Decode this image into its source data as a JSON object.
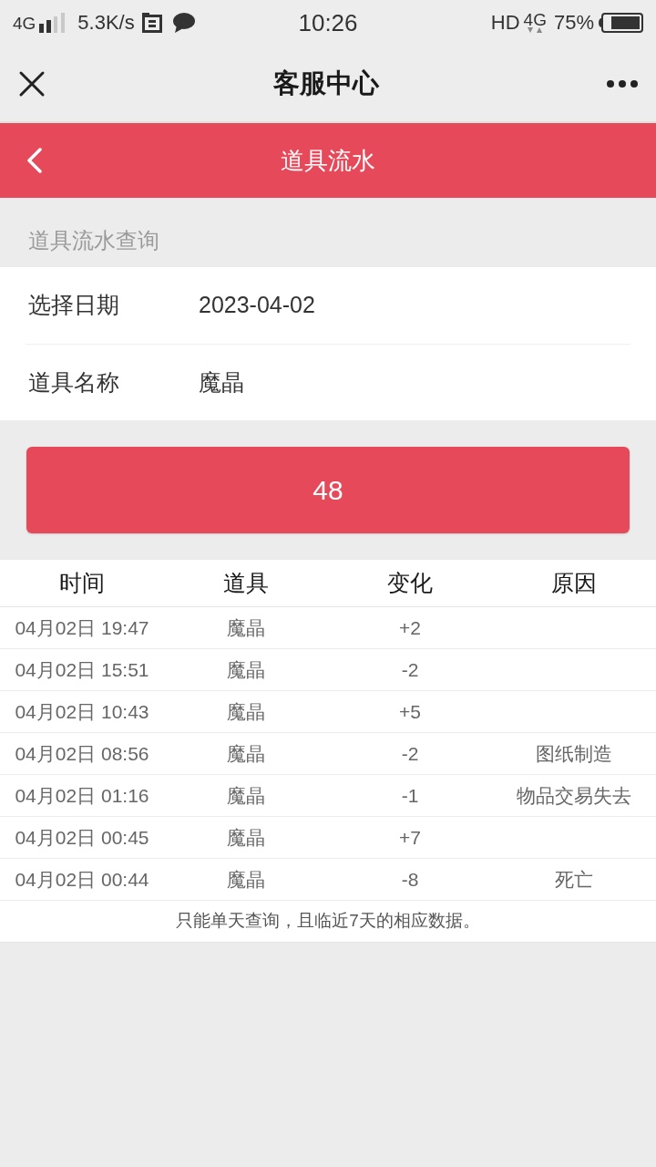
{
  "status_bar": {
    "network": "4G",
    "speed": "5.3K/s",
    "time": "10:26",
    "hd": "HD",
    "network_right": "4G",
    "battery": "75%"
  },
  "title_bar": {
    "title": "客服中心"
  },
  "header": {
    "title": "道具流水"
  },
  "section_label": "道具流水查询",
  "form": [
    {
      "label": "选择日期",
      "value": "2023-04-02"
    },
    {
      "label": "道具名称",
      "value": "魔晶"
    }
  ],
  "query_button": {
    "label": "48"
  },
  "table": {
    "columns": [
      "时间",
      "道具",
      "变化",
      "原因"
    ],
    "rows": [
      {
        "time": "04月02日 19:47",
        "item": "魔晶",
        "change": "+2"
      },
      {
        "time": "04月02日 15:51",
        "item": "魔晶",
        "change": "-2"
      },
      {
        "time": "04月02日 10:43",
        "item": "魔晶",
        "change": "+5"
      },
      {
        "time": "04月02日 08:56",
        "item": "魔晶",
        "change": "-2",
        "reason": "图纸制造"
      },
      {
        "time": "04月02日 01:16",
        "item": "魔晶",
        "change": "-1",
        "reason": "物品交易失去"
      },
      {
        "time": "04月02日 00:45",
        "item": "魔晶",
        "change": "+7"
      },
      {
        "time": "04月02日 00:44",
        "item": "魔晶",
        "change": "-8",
        "reason": "死亡"
      }
    ],
    "note": "只能单天查询，且临近7天的相应数据。"
  }
}
